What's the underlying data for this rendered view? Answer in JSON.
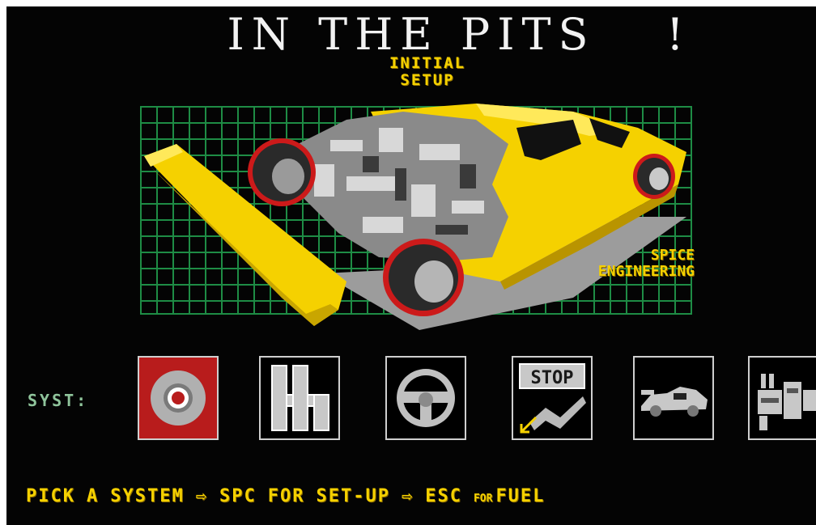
{
  "title": {
    "text": "IN THE PITS",
    "exclaim": "!"
  },
  "subtitle": {
    "line1": "INITIAL",
    "line2": "SETUP"
  },
  "brand": {
    "line1": "SPICE",
    "line2": "ENGINEERING"
  },
  "systems": {
    "label": "SYST:",
    "items": [
      {
        "icon": "brake-disc-icon",
        "selected": true
      },
      {
        "icon": "gear-shift-icon",
        "selected": false
      },
      {
        "icon": "steering-wheel-icon",
        "selected": false
      },
      {
        "icon": "pit-stop-sign-icon",
        "stop_text": "STOP",
        "selected": false
      },
      {
        "icon": "car-profile-icon",
        "selected": false
      },
      {
        "icon": "engine-icon",
        "selected": false
      }
    ]
  },
  "footer": {
    "pick": "PICK",
    "a": "A",
    "system": "SYSTEM",
    "arrow": "⇨",
    "spc": "SPC",
    "for1": "FOR",
    "setup": "SET-UP",
    "esc": "ESC",
    "for2": "FOR",
    "fuel": "FUEL"
  },
  "colors": {
    "background": "#040404",
    "accent_yellow": "#f5d100",
    "grid_green": "#1e8c45",
    "tyre_red": "#cc1a1a",
    "selected_button_bg": "#b81c1c"
  }
}
